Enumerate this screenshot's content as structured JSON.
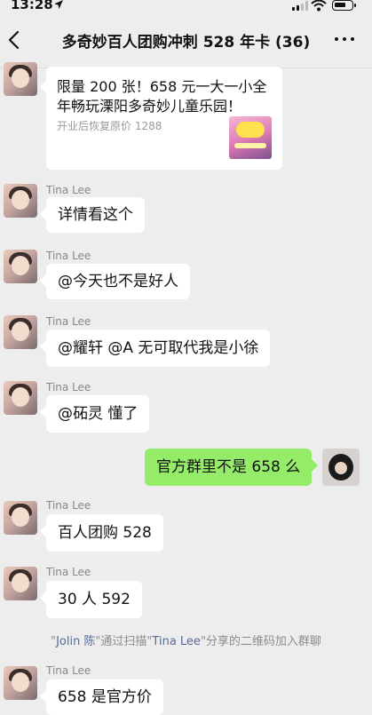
{
  "status_bar": {
    "time": "13:28"
  },
  "header": {
    "title": "多奇妙百人团购冲刺 528 年卡 (36)"
  },
  "card": {
    "title": "限量 200 张！658 元一大一小全年畅玩溧阳多奇妙儿童乐园！",
    "subtitle": "开业后恢复原价 1288"
  },
  "messages": [
    {
      "sender": "Tina Lee",
      "text": "详情看这个"
    },
    {
      "sender": "Tina Lee",
      "text": "@今天也不是好人"
    },
    {
      "sender": "Tina Lee",
      "text": "@耀轩 @A 无可取代我是小徐"
    },
    {
      "sender": "Tina Lee",
      "text": "@砳灵 懂了"
    },
    {
      "sender": "",
      "text": "官方群里不是 658 么"
    },
    {
      "sender": "Tina Lee",
      "text": "百人团购 528"
    },
    {
      "sender": "Tina Lee",
      "text": "30 人 592"
    },
    {
      "sender": "Tina Lee",
      "text": "658 是官方价"
    }
  ],
  "system": {
    "quote_open": "\"",
    "user": "Jolin 陈",
    "text1": "\"通过扫描\"",
    "inviter": "Tina Lee",
    "text2": "\"分享的二维码加入群聊"
  }
}
